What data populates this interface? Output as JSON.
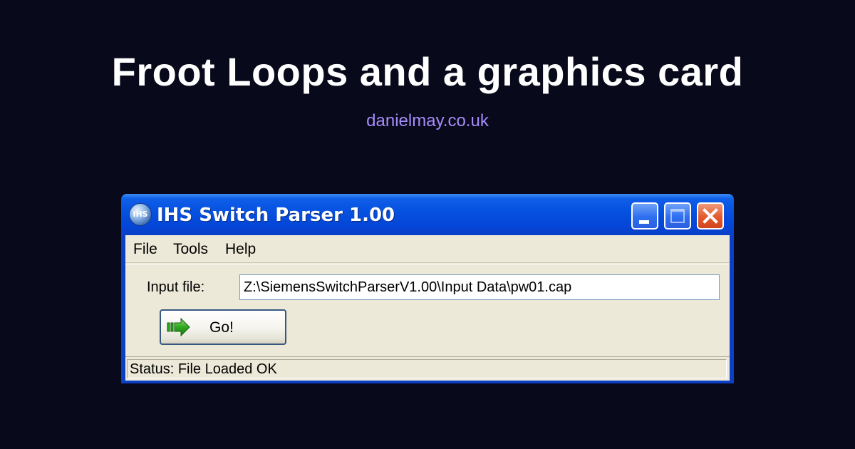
{
  "header": {
    "title": "Froot Loops and a graphics card",
    "site": "danielmay.co.uk"
  },
  "window": {
    "icon_text": "IHS",
    "title": "IHS Switch Parser 1.00",
    "menu": [
      "File",
      "Tools",
      "Help"
    ],
    "input_label": "Input file:",
    "input_value": "Z:\\SiemensSwitchParserV1.00\\Input Data\\pw01.cap",
    "go_label": "Go!",
    "status": "Status: File Loaded OK"
  },
  "icons": {
    "app": "ihs-logo-icon",
    "minimize": "minimize-icon",
    "maximize": "maximize-icon",
    "close": "close-icon",
    "go": "green-arrow-icon"
  },
  "colors": {
    "page_background": "#080a1b",
    "site_link": "#a78bfa",
    "titlebar": "#0650e0",
    "close_button": "#e3592d",
    "window_face": "#ece9d8"
  }
}
